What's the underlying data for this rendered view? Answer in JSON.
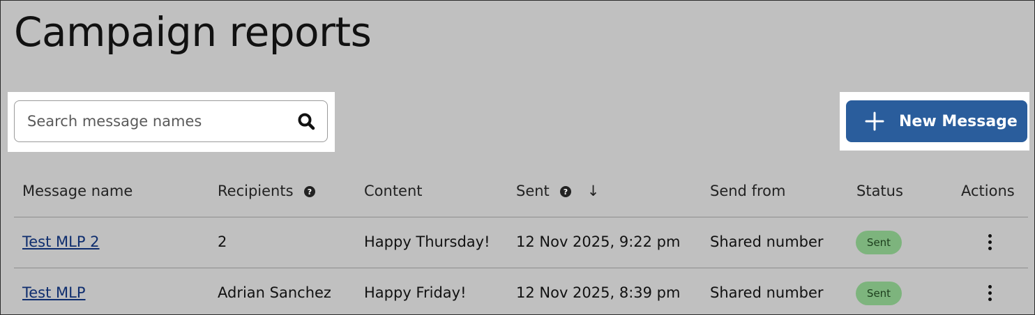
{
  "page": {
    "title": "Campaign reports"
  },
  "search": {
    "placeholder": "Search message names",
    "value": ""
  },
  "toolbar": {
    "new_message_label": "New Message"
  },
  "colors": {
    "primary": "#2a5d9c",
    "status_sent_bg": "#7db47d",
    "link": "#0e2d6e"
  },
  "table": {
    "columns": {
      "name": "Message name",
      "recipients": "Recipients",
      "content": "Content",
      "sent": "Sent",
      "send_from": "Send from",
      "status": "Status",
      "actions": "Actions"
    },
    "sort": {
      "column": "sent",
      "direction": "descending"
    },
    "rows": [
      {
        "name": "Test MLP 2",
        "recipients": "2",
        "content": "Happy Thursday!",
        "sent": "12 Nov 2025, 9:22 pm",
        "send_from": "Shared number",
        "status": "Sent"
      },
      {
        "name": "Test MLP",
        "recipients": "Adrian Sanchez",
        "content": "Happy Friday!",
        "sent": "12 Nov 2025, 8:39 pm",
        "send_from": "Shared number",
        "status": "Sent"
      }
    ]
  }
}
